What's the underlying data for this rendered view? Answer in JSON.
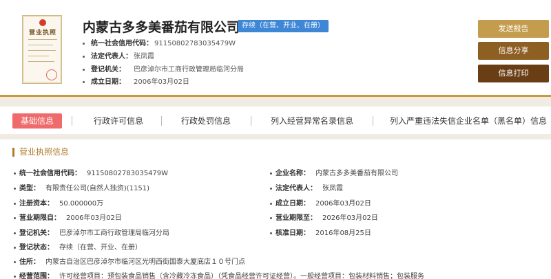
{
  "header": {
    "license_title": "营业执照",
    "company_name": "内蒙古多多美番茄有限公司",
    "status": "存续（在营、开业、在册）",
    "info": [
      {
        "key": "统一社会信用代码：",
        "value": "91150802783035479W"
      },
      {
        "key": "法定代表人：",
        "value": "张凤霞"
      },
      {
        "key": "登记机关：",
        "value": "巴彦淖尔市工商行政管理局临河分局"
      },
      {
        "key": "成立日期：",
        "value": "2006年03月02日"
      }
    ],
    "buttons": {
      "report": "发送报告",
      "share": "信息分享",
      "print": "信息打印"
    }
  },
  "tabs": [
    {
      "label": "基础信息"
    },
    {
      "label": "行政许可信息"
    },
    {
      "label": "行政处罚信息"
    },
    {
      "label": "列入经营异常名录信息"
    },
    {
      "label": "列入严重违法失信企业名单（黑名单）信息"
    }
  ],
  "section": {
    "title": "营业执照信息",
    "left": [
      {
        "key": "统一社会信用代码：",
        "value": "91150802783035479W"
      },
      {
        "key": "类型：",
        "value": "有限责任公司(自然人独资)(1151)"
      },
      {
        "key": "注册资本：",
        "value": "50.000000万"
      },
      {
        "key": "营业期限自：",
        "value": "2006年03月02日"
      },
      {
        "key": "登记机关：",
        "value": "巴彦淖尔市工商行政管理局临河分局"
      },
      {
        "key": "登记状态：",
        "value": "存续（在营、开业、在册）"
      }
    ],
    "right": [
      {
        "key": "企业名称：",
        "value": "内蒙古多多美番茄有限公司"
      },
      {
        "key": "法定代表人：",
        "value": "张凤霞"
      },
      {
        "key": "成立日期：",
        "value": "2006年03月02日"
      },
      {
        "key": "营业期限至：",
        "value": "2026年03月02日"
      },
      {
        "key": "核准日期：",
        "value": "2016年08月25日"
      }
    ],
    "address": {
      "key": "住所：",
      "value": "内蒙古自治区巴彦淖尔市临河区光明西街国泰大厦底店１０号门点"
    },
    "scope": {
      "key": "经营范围：",
      "value": "许可经营项目：预包装食品销售（含冷藏冷冻食品）（凭食品经营许可证经营）。一般经营项目：包装材料销售；包装服务"
    }
  }
}
